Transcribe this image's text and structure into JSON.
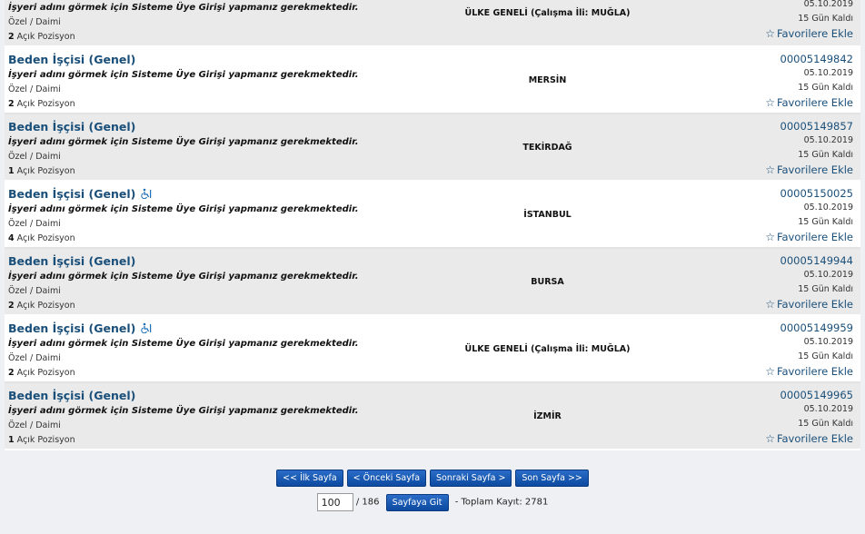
{
  "jobs": [
    {
      "title": "",
      "employer": "İşyeri adını görmek için Sisteme Üye Girişi yapmanız gerekmektedir.",
      "type": "Özel / Daimi",
      "positions_count": "2",
      "positions_label": "Açık Pozisyon",
      "location": "ÜLKE GENELİ (Çalışma İli: MUĞLA)",
      "code": "",
      "date": "05.10.2019",
      "days_left": "15 Gün Kaldı",
      "favorite": "Favorilere Ekle",
      "disabled_icon": false
    },
    {
      "title": "Beden İşçisi (Genel)",
      "employer": "İşyeri adını görmek için Sisteme Üye Girişi yapmanız gerekmektedir.",
      "type": "Özel / Daimi",
      "positions_count": "2",
      "positions_label": "Açık Pozisyon",
      "location": "MERSİN",
      "code": "00005149842",
      "date": "05.10.2019",
      "days_left": "15 Gün Kaldı",
      "favorite": "Favorilere Ekle",
      "disabled_icon": false
    },
    {
      "title": "Beden İşçisi (Genel)",
      "employer": "İşyeri adını görmek için Sisteme Üye Girişi yapmanız gerekmektedir.",
      "type": "Özel / Daimi",
      "positions_count": "1",
      "positions_label": "Açık Pozisyon",
      "location": "TEKİRDAĞ",
      "code": "00005149857",
      "date": "05.10.2019",
      "days_left": "15 Gün Kaldı",
      "favorite": "Favorilere Ekle",
      "disabled_icon": false
    },
    {
      "title": "Beden İşçisi (Genel)",
      "employer": "İşyeri adını görmek için Sisteme Üye Girişi yapmanız gerekmektedir.",
      "type": "Özel / Daimi",
      "positions_count": "4",
      "positions_label": "Açık Pozisyon",
      "location": "İSTANBUL",
      "code": "00005150025",
      "date": "05.10.2019",
      "days_left": "15 Gün Kaldı",
      "favorite": "Favorilere Ekle",
      "disabled_icon": true
    },
    {
      "title": "Beden İşçisi (Genel)",
      "employer": "İşyeri adını görmek için Sisteme Üye Girişi yapmanız gerekmektedir.",
      "type": "Özel / Daimi",
      "positions_count": "2",
      "positions_label": "Açık Pozisyon",
      "location": "BURSA",
      "code": "00005149944",
      "date": "05.10.2019",
      "days_left": "15 Gün Kaldı",
      "favorite": "Favorilere Ekle",
      "disabled_icon": false
    },
    {
      "title": "Beden İşçisi (Genel)",
      "employer": "İşyeri adını görmek için Sisteme Üye Girişi yapmanız gerekmektedir.",
      "type": "Özel / Daimi",
      "positions_count": "2",
      "positions_label": "Açık Pozisyon",
      "location": "ÜLKE GENELİ (Çalışma İli: MUĞLA)",
      "code": "00005149959",
      "date": "05.10.2019",
      "days_left": "15 Gün Kaldı",
      "favorite": "Favorilere Ekle",
      "disabled_icon": true
    },
    {
      "title": "Beden İşçisi (Genel)",
      "employer": "İşyeri adını görmek için Sisteme Üye Girişi yapmanız gerekmektedir.",
      "type": "Özel / Daimi",
      "positions_count": "1",
      "positions_label": "Açık Pozisyon",
      "location": "İZMİR",
      "code": "00005149965",
      "date": "05.10.2019",
      "days_left": "15 Gün Kaldı",
      "favorite": "Favorilere Ekle",
      "disabled_icon": false
    }
  ],
  "pager": {
    "first": "<< İlk Sayfa",
    "prev": "< Önceki Sayfa",
    "next": "Sonraki Sayfa >",
    "last": "Son Sayfa >>",
    "page_value": "100",
    "total_pages": "/ 186",
    "go_button": "Sayfaya Git",
    "total_records": "- Toplam Kayıt: 2781"
  },
  "colors": {
    "link": "#1a4f7a",
    "button": "#1558b0"
  }
}
